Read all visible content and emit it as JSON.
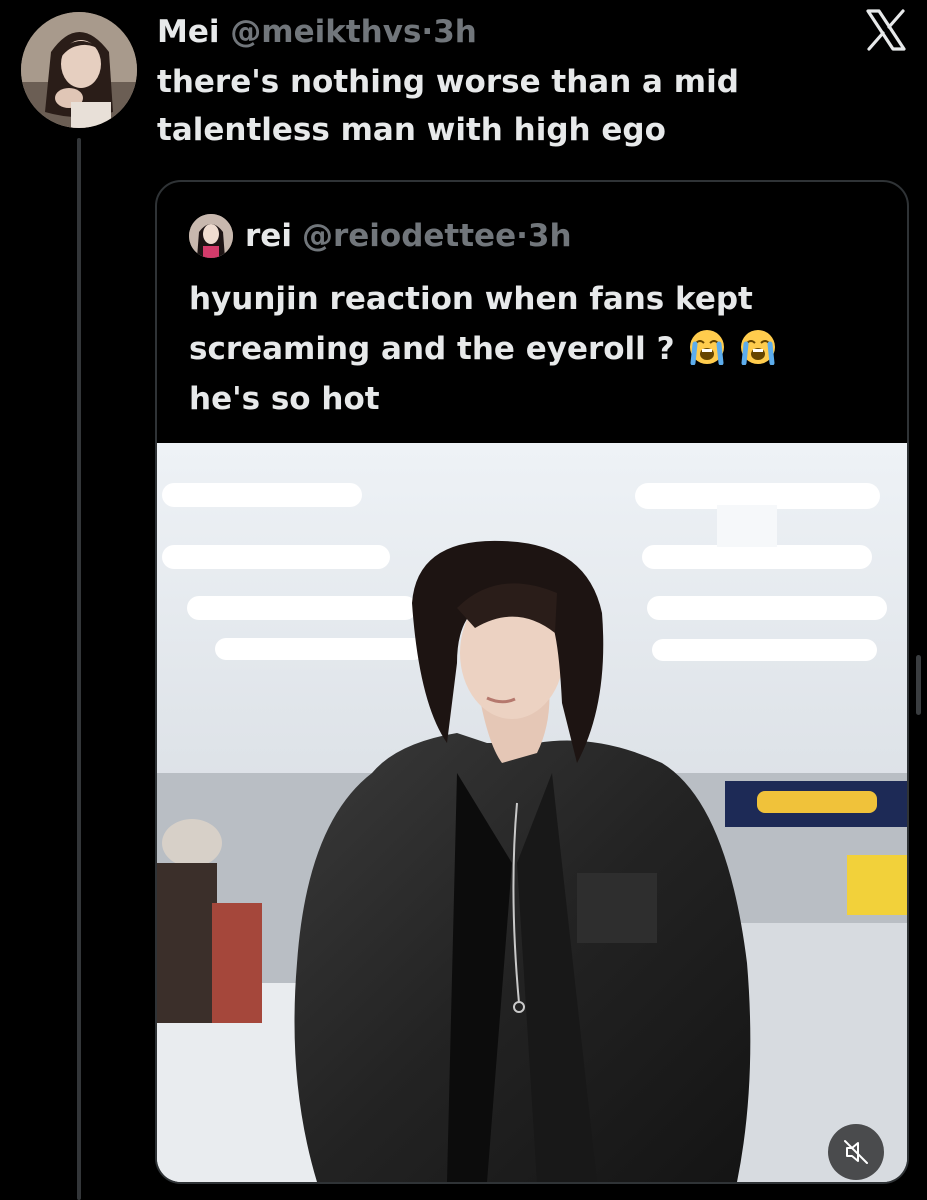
{
  "tweet": {
    "author_name": "Mei",
    "author_handle": "@meikthvs",
    "separator": "·",
    "time": "3h",
    "text": "there's nothing worse than a mid talentless man with high ego"
  },
  "quoted_tweet": {
    "author_name": "rei",
    "author_handle": "@reiodettee",
    "separator": "·",
    "time": "3h",
    "text_line1": "hyunjin reaction when fans kept",
    "text_line2": "screaming and the eyeroll ?",
    "emojis": [
      "loudly-crying-face-emoji",
      "loudly-crying-face-emoji"
    ],
    "text_line3": "he's so hot"
  },
  "icons": {
    "close": "x-logo-icon",
    "mute": "muted-speaker-icon"
  },
  "colors": {
    "background": "#000000",
    "primary_text": "#e7e9ea",
    "secondary_text": "#71767b",
    "border": "#2f3336"
  }
}
